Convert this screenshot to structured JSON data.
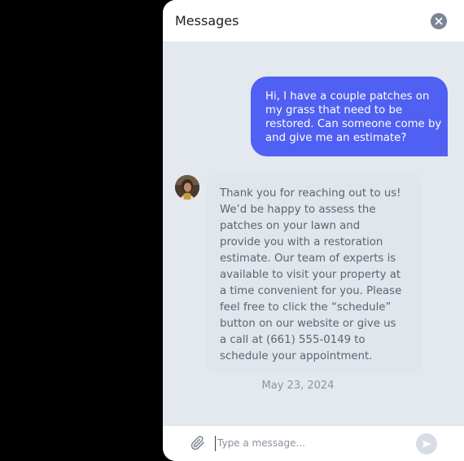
{
  "header": {
    "title": "Messages",
    "close_icon": "close-icon"
  },
  "conversation": {
    "outgoing": {
      "lines": [
        "Hi, I have a couple patches on",
        "my grass that need to be",
        "restored. Can someone come by",
        "and give me an estimate?"
      ]
    },
    "incoming": {
      "avatar_icon": "avatar",
      "lines": [
        "Thank you for reaching out to us!",
        "We’d be happy to assess the",
        "patches on your lawn and",
        "provide you with a restoration",
        "estimate. Our team of experts is",
        "available to visit your property at",
        "a time convenient for you. Please",
        "feel free to click the “schedule”",
        "button on our website or give us",
        "a call at (661) 555-0149 to",
        "schedule your appointment."
      ]
    },
    "date": "May 23, 2024"
  },
  "composer": {
    "attach_icon": "paperclip-icon",
    "placeholder": "Type a message...",
    "value": "",
    "send_icon": "send-icon"
  },
  "colors": {
    "outgoing_bubble": "#5060f2",
    "panel_bg": "#e4e8ef",
    "incoming_bubble": "#e1e5ec"
  }
}
